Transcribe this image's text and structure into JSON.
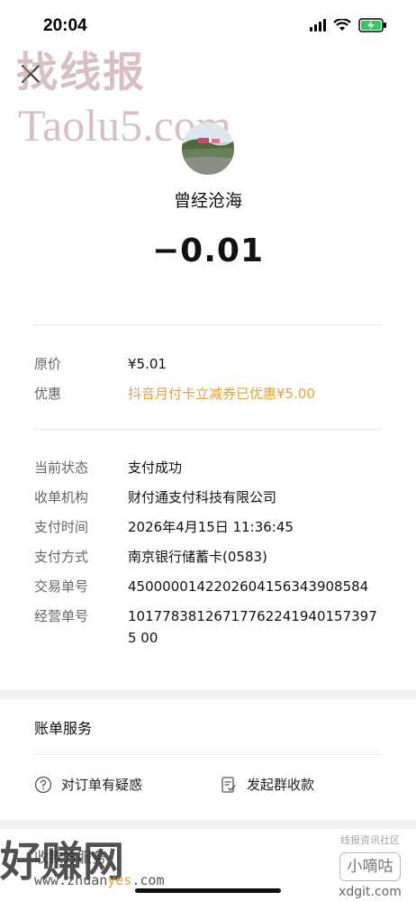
{
  "status_bar": {
    "time": "20:04"
  },
  "watermarks": {
    "top_cn": "找线报",
    "top_site": "Taolu5.com",
    "bottom_cn": "好赚网",
    "bottom_site_a": "www.zhuan",
    "bottom_site_b": "yes",
    "bottom_site_c": ".com",
    "right_small": "线报资讯社区",
    "right_box": "小嘀咕",
    "right_domain": "xdgit.com"
  },
  "payee": {
    "name": "曾经沧海"
  },
  "amount": "−0.01",
  "price_section": {
    "rows": [
      {
        "label": "原价",
        "value": "¥5.01"
      },
      {
        "label": "优惠",
        "value": "抖音月付卡立减券已优惠¥5.00"
      }
    ]
  },
  "detail_section": {
    "rows": [
      {
        "label": "当前状态",
        "value": "支付成功"
      },
      {
        "label": "收单机构",
        "value": "财付通支付科技有限公司"
      },
      {
        "label": "支付时间",
        "value": "2026年4月15日 11:36:45"
      },
      {
        "label": "支付方式",
        "value": "南京银行储蓄卡(0583)"
      },
      {
        "label": "交易单号",
        "value": "4500000142202604156343908584"
      },
      {
        "label": "经营单号",
        "value": "101778381267177622419401573975 00"
      }
    ]
  },
  "bill_services": {
    "title": "账单服务",
    "items": [
      {
        "label": "对订单有疑惑",
        "icon": "question-circle-icon"
      },
      {
        "label": "发起群收款",
        "icon": "group-collect-icon"
      }
    ]
  },
  "bottom_partial_label": "收款方服务",
  "colors": {
    "accent_orange": "#e5a13a",
    "label_gray": "#666666",
    "divider": "#e9e9e9"
  }
}
